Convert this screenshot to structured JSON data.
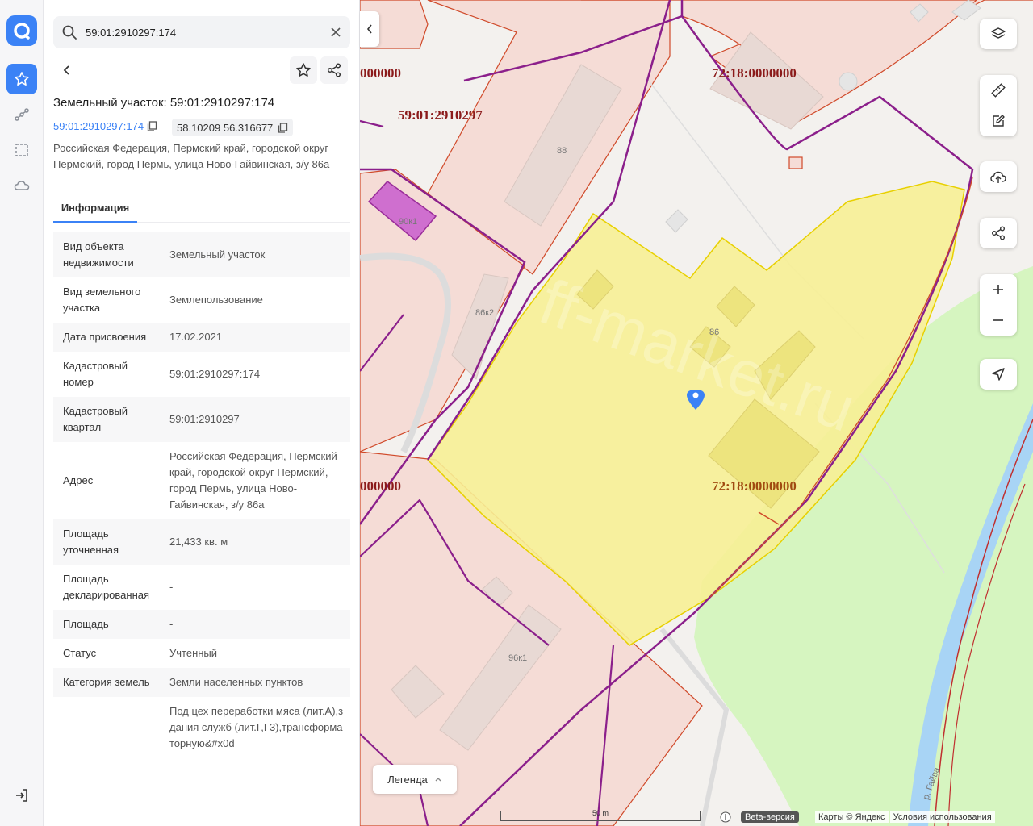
{
  "search": {
    "value": "59:01:2910297:174"
  },
  "object": {
    "title": "Земельный участок: 59:01:2910297:174",
    "cadastral_link": "59:01:2910297:174",
    "coords": "58.10209 56.316677",
    "address": "Российская Федерация, Пермский край, городской округ Пермский, город Пермь, улица Ново-Гайвинская, з/у 86а"
  },
  "tabs": [
    {
      "label": "Информация"
    }
  ],
  "info": [
    {
      "key": "Вид объекта недвижимости",
      "value": "Земельный участок"
    },
    {
      "key": "Вид земельного участка",
      "value": "Землепользование"
    },
    {
      "key": "Дата присвоения",
      "value": "17.02.2021"
    },
    {
      "key": "Кадастровый номер",
      "value": "59:01:2910297:174"
    },
    {
      "key": "Кадастровый квартал",
      "value": "59:01:2910297"
    },
    {
      "key": "Адрес",
      "value": "Российская Федерация, Пермский край, городской округ Пермский, город Пермь, улица Ново-Гайвинская, з/у 86а"
    },
    {
      "key": "Площадь уточненная",
      "value": "21,433 кв. м"
    },
    {
      "key": "Площадь декларированная",
      "value": "-"
    },
    {
      "key": "Площадь",
      "value": "-"
    },
    {
      "key": "Статус",
      "value": "Учтенный"
    },
    {
      "key": "Категория земель",
      "value": "Земли населенных пунктов"
    },
    {
      "key": "",
      "value": "Под цех переработки мяса (лит.А),здания служб (лит.Г,Г3),трансформаторную&#x0d"
    }
  ],
  "map": {
    "labels": {
      "top_left_partial": "000000",
      "top_right": "72:18:0000000",
      "quarter": "59:01:2910297",
      "bottom_left_partial": "000000",
      "bottom_right": "72:18:0000000"
    },
    "buildings": {
      "b88": "88",
      "b90k1": "90к1",
      "b86k2": "86к2",
      "b86": "86",
      "b96k1": "96к1"
    },
    "river": "р. Гайва",
    "watermark": "ff-market.ru"
  },
  "legend": {
    "label": "Легенда"
  },
  "footer": {
    "scale": "50 m",
    "beta": "Beta-версия",
    "maps": "Карты © Яндекс",
    "terms": "Условия использования"
  },
  "colors": {
    "accent": "#3b82f6",
    "parcel_fill": "#f7ef95",
    "parcel_border": "#e8d000",
    "boundary_purple": "#8b1f8b",
    "boundary_red": "#d04a2a",
    "green_area": "#d6f5c0",
    "river": "#a8d4f5"
  }
}
